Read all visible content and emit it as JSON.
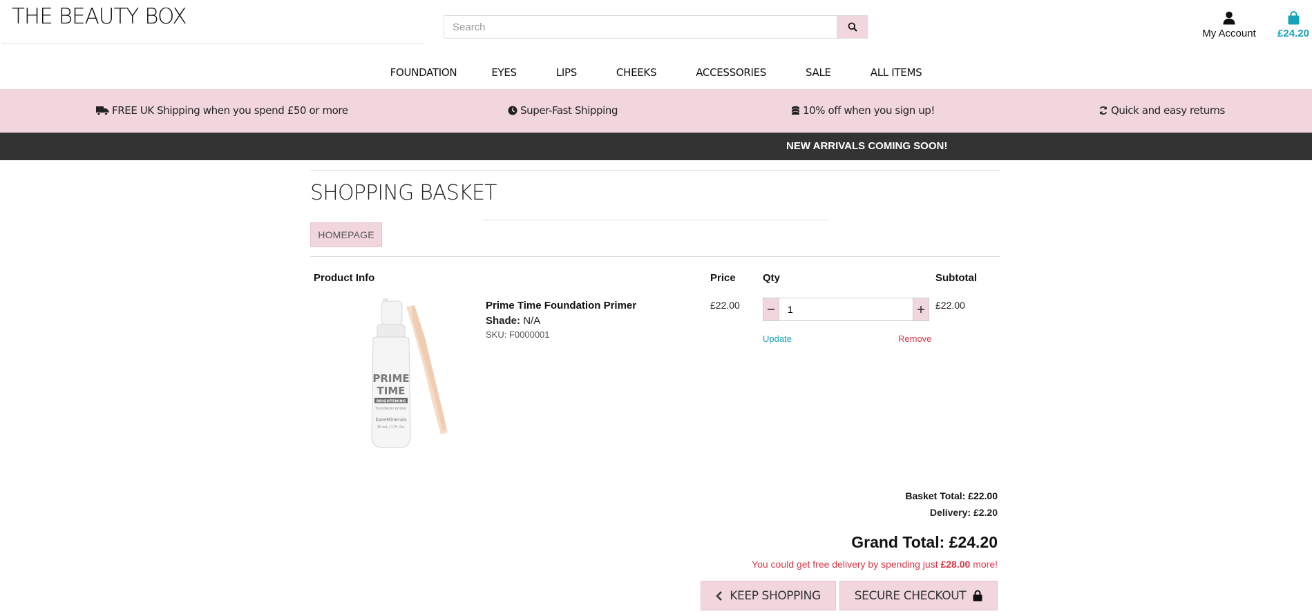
{
  "header": {
    "logo": "THE BEAUTY BOX",
    "search_placeholder": "Search",
    "account_label": "My Account",
    "basket_total": "£24.20"
  },
  "nav": [
    "FOUNDATION",
    "EYES",
    "LIPS",
    "CHEEKS",
    "ACCESSORIES",
    "SALE",
    "ALL ITEMS"
  ],
  "promo": {
    "shipping": "FREE UK Shipping when you spend £50 or more",
    "fast": "Super-Fast Shipping",
    "signup": "10% off when you sign up!",
    "returns": "Quick and easy returns"
  },
  "banner": "NEW ARRIVALS COMING SOON!",
  "page": {
    "title": "SHOPPING BASKET",
    "homepage_button": "HOMEPAGE"
  },
  "table": {
    "headers": {
      "product": "Product Info",
      "price": "Price",
      "qty": "Qty",
      "subtotal": "Subtotal"
    }
  },
  "item": {
    "name": "Prime Time Foundation Primer",
    "shade_label": "Shade:",
    "shade_value": "N/A",
    "sku": "SKU: F0000001",
    "price": "£22.00",
    "qty": "1",
    "update": "Update",
    "remove": "Remove",
    "subtotal": "£22.00",
    "image_text": {
      "line1": "PRIME",
      "line2": "TIME",
      "line3": "BRIGHTENING",
      "line4": "foundation primer",
      "line5": "bareMinerals",
      "line6": "30 mL / 1 Fl. Oz."
    }
  },
  "summary": {
    "basket_total": "Basket Total: £22.00",
    "delivery": "Delivery: £2.20",
    "grand_total": "Grand Total: £24.20",
    "free_prefix": "You could get free delivery by spending just ",
    "free_amount": "£28.00",
    "free_suffix": " more!"
  },
  "buttons": {
    "keep_shopping": "KEEP SHOPPING",
    "secure_checkout": "SECURE CHECKOUT"
  },
  "colors": {
    "pink": "#f2d6de",
    "dark": "#333333",
    "teal": "#17a2b8",
    "red": "#dc3545"
  }
}
